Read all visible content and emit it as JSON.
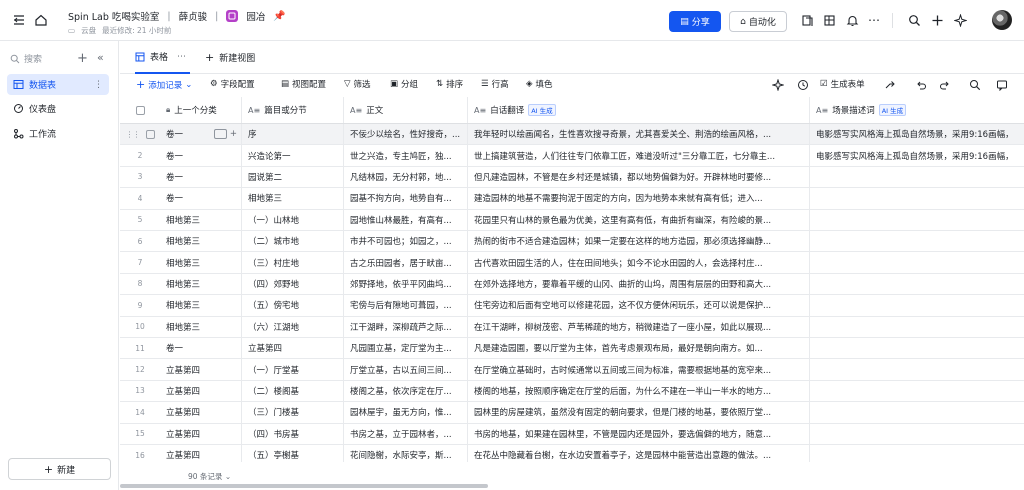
{
  "header": {
    "workspace": "Spin Lab 吃喝实验室",
    "author": "薛贞骏",
    "base_name": "园冶",
    "location": "云盘",
    "last_modified": "最近修改: 21 小时前",
    "share_label": "分享",
    "automation_label": "自动化"
  },
  "sidebar": {
    "search_placeholder": "搜索",
    "items": [
      {
        "label": "数据表",
        "icon": "table-icon"
      },
      {
        "label": "仪表盘",
        "icon": "dashboard-icon"
      },
      {
        "label": "工作流",
        "icon": "workflow-icon"
      }
    ],
    "new_label": "新建"
  },
  "view_tabs": {
    "active": "表格",
    "new_view": "新建视图"
  },
  "toolbar": {
    "add_record": "添加记录",
    "field_config": "字段配置",
    "view_config": "视图配置",
    "filter": "筛选",
    "group": "分组",
    "sort": "排序",
    "row_height": "行高",
    "fill_color": "填色",
    "generate_form": "生成表单"
  },
  "columns": [
    {
      "label": "上一个分类",
      "icon": "⌂"
    },
    {
      "label": "篇目或分节",
      "icon": "A≡"
    },
    {
      "label": "正文",
      "icon": "A≡"
    },
    {
      "label": "白话翻译",
      "icon": "A≡",
      "ai_badge": "AI 生成"
    },
    {
      "label": "场景描述词",
      "icon": "A≡",
      "ai_badge": "AI 生成"
    }
  ],
  "rows": [
    {
      "n": "",
      "c1": "卷一",
      "c2": "序",
      "c3": "不佞少以绘名，性好搜奇，...",
      "c4": "我年轻时以绘画闻名，生性喜欢搜寻奇景，尤其喜爱关仝、荆浩的绘画风格，...",
      "c5": "电影感写实风格海上孤岛自然场景，采用9:16画幅，"
    },
    {
      "n": "2",
      "c1": "卷一",
      "c2": "兴造论第一",
      "c3": "世之兴造，专主鸠匠，独...",
      "c4": "世上搞建筑营造，人们往往专门依靠工匠，难道没听过\"三分靠工匠，七分靠主...",
      "c5": "电影感写实风格海上孤岛自然场景，采用9:16画幅，"
    },
    {
      "n": "3",
      "c1": "卷一",
      "c2": "园说第二",
      "c3": "凡结林园，无分村郭，地...",
      "c4": "但凡建造园林，不管是在乡村还是城镇，都以地势偏僻为好。开辟林地时要修...",
      "c5": ""
    },
    {
      "n": "4",
      "c1": "卷一",
      "c2": "相地第三",
      "c3": "园基不拘方向，地势自有...",
      "c4": "建造园林的地基不需要拘泥于固定的方向，因为地势本来就有高有低；进入...",
      "c5": ""
    },
    {
      "n": "5",
      "c1": "相地第三",
      "c2": "（一）山林地",
      "c3": "园地惟山林最胜，有高有...",
      "c4": "花园里只有山林的景色最为优美，这里有高有低，有曲折有幽深，有险峻的景...",
      "c5": ""
    },
    {
      "n": "6",
      "c1": "相地第三",
      "c2": "（二）城市地",
      "c3": "市井不可园也；如园之，...",
      "c4": "热闹的街市不适合建造园林；如果一定要在这样的地方造园，那必须选择幽静...",
      "c5": ""
    },
    {
      "n": "7",
      "c1": "相地第三",
      "c2": "（三）村庄地",
      "c3": "古之乐田园者，居于畎亩...",
      "c4": "古代喜欢田园生活的人，住在田间地头；如今不论水田园的人，会选择村庄...",
      "c5": ""
    },
    {
      "n": "8",
      "c1": "相地第三",
      "c2": "（四）郊野地",
      "c3": "郊野择地，依乎平冈曲坞...",
      "c4": "在郊外选择地方，要靠着平缓的山冈、曲折的山坞，周围有层层的田野和高大...",
      "c5": ""
    },
    {
      "n": "9",
      "c1": "相地第三",
      "c2": "（五）傍宅地",
      "c3": "宅傍与后有隙地可葺园，...",
      "c4": "住宅旁边和后面有空地可以修建花园，这不仅方便休闲玩乐，还可以说是保护...",
      "c5": ""
    },
    {
      "n": "10",
      "c1": "相地第三",
      "c2": "（六）江湖地",
      "c3": "江干湖畔，深柳疏芦之际...",
      "c4": "在江干湖畔，柳树茂密、芦苇稀疏的地方，稍微建造了一座小屋，如此以展现...",
      "c5": ""
    },
    {
      "n": "11",
      "c1": "卷一",
      "c2": "立基第四",
      "c3": "凡园圃立基，定厅堂为主...",
      "c4": "凡是建造园圃，要以厅堂为主体，首先考虑景观布局，最好是朝向南方。如...",
      "c5": ""
    },
    {
      "n": "12",
      "c1": "立基第四",
      "c2": "（一）厅堂基",
      "c3": "厅堂立基，古以五间三间...",
      "c4": "在厅堂确立基础时，古时候通常以五间或三间为标准，需要根据地基的宽窄来...",
      "c5": ""
    },
    {
      "n": "13",
      "c1": "立基第四",
      "c2": "（二）楼阁基",
      "c3": "楼阁之基，依次序定在厅...",
      "c4": "楼阁的地基，按照顺序确定在厅堂的后面，为什么不建在一半山一半水的地方...",
      "c5": ""
    },
    {
      "n": "14",
      "c1": "立基第四",
      "c2": "（三）门楼基",
      "c3": "园林屋宇，虽无方向，惟...",
      "c4": "园林里的房屋建筑，虽然没有固定的朝向要求，但是门楼的地基，要依照厅堂...",
      "c5": ""
    },
    {
      "n": "15",
      "c1": "立基第四",
      "c2": "（四）书房基",
      "c3": "书房之基，立于园林者，...",
      "c4": "书房的地基，如果建在园林里，不管是园内还是园外，要选偏僻的地方，随意...",
      "c5": ""
    },
    {
      "n": "16",
      "c1": "立基第四",
      "c2": "（五）亭榭基",
      "c3": "花间隐榭，水际安亭，斯...",
      "c4": "在花丛中隐藏着台榭，在水边安置着亭子，这是园林中能营造出意趣的做法。...",
      "c5": ""
    }
  ],
  "footer": {
    "record_count": "90 条记录"
  }
}
